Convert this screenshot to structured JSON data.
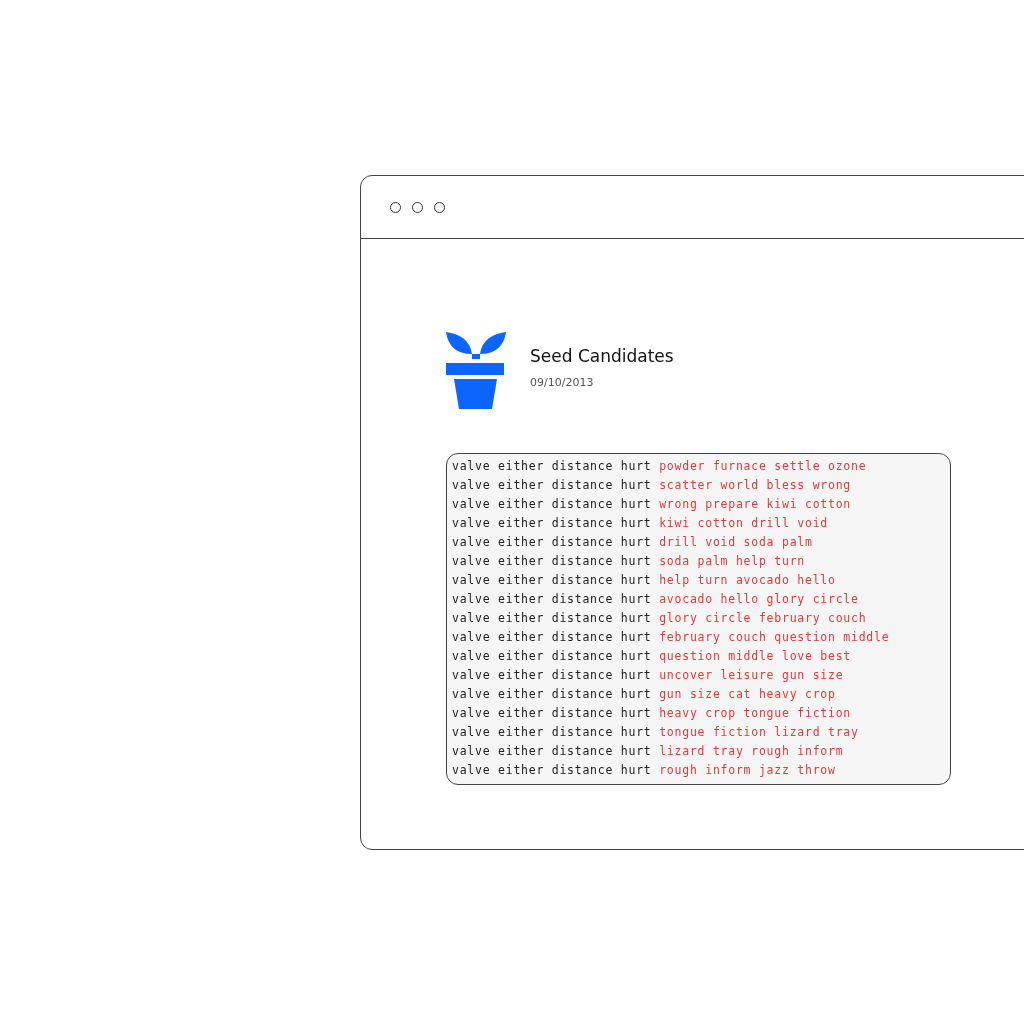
{
  "document": {
    "title": "Seed Candidates",
    "date": "09/10/2013"
  },
  "code_lines": [
    {
      "prefix": "valve either distance hurt",
      "highlight": "powder furnace settle ozone"
    },
    {
      "prefix": "valve either distance hurt",
      "highlight": "scatter world bless wrong"
    },
    {
      "prefix": "valve either distance hurt",
      "highlight": "wrong prepare kiwi cotton"
    },
    {
      "prefix": "valve either distance hurt",
      "highlight": "kiwi cotton drill void"
    },
    {
      "prefix": "valve either distance hurt",
      "highlight": "drill void soda palm"
    },
    {
      "prefix": "valve either distance hurt",
      "highlight": "soda palm help turn"
    },
    {
      "prefix": "valve either distance hurt",
      "highlight": "help turn avocado hello"
    },
    {
      "prefix": "valve either distance hurt",
      "highlight": "avocado hello glory circle"
    },
    {
      "prefix": "valve either distance hurt",
      "highlight": "glory circle february couch"
    },
    {
      "prefix": "valve either distance hurt",
      "highlight": "february couch question middle"
    },
    {
      "prefix": "valve either distance hurt",
      "highlight": "question middle love best"
    },
    {
      "prefix": "valve either distance hurt",
      "highlight": "uncover leisure gun size"
    },
    {
      "prefix": "valve either distance hurt",
      "highlight": "gun size cat heavy crop"
    },
    {
      "prefix": "valve either distance hurt",
      "highlight": "heavy crop tongue fiction"
    },
    {
      "prefix": "valve either distance hurt",
      "highlight": "tongue fiction lizard tray"
    },
    {
      "prefix": "valve either distance hurt",
      "highlight": "lizard tray rough inform"
    },
    {
      "prefix": "valve either distance hurt",
      "highlight": "rough inform jazz throw"
    }
  ]
}
